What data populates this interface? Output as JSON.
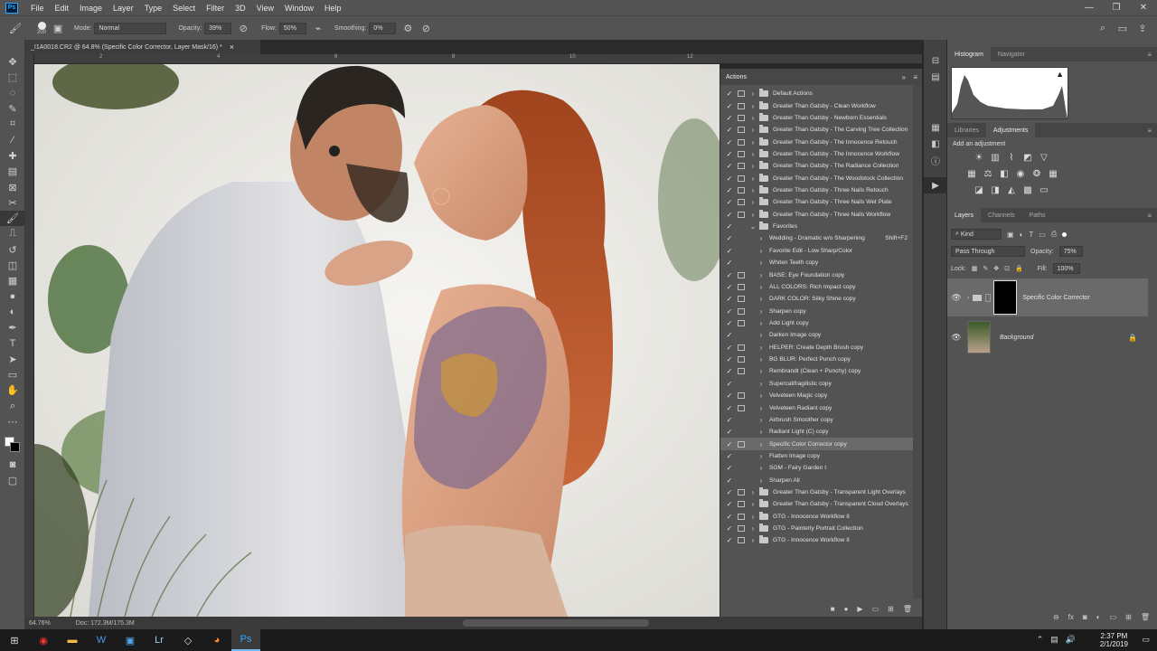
{
  "app": {
    "logo": "Ps"
  },
  "menubar": {
    "items": [
      "File",
      "Edit",
      "Image",
      "Layer",
      "Type",
      "Select",
      "Filter",
      "3D",
      "View",
      "Window",
      "Help"
    ],
    "controls": [
      "—",
      "❐",
      "✕"
    ]
  },
  "options": {
    "brush_size": "200",
    "mode_label": "Mode:",
    "mode_value": "Normal",
    "opacity_label": "Opacity:",
    "opacity_value": "39%",
    "flow_label": "Flow:",
    "flow_value": "50%",
    "smoothing_label": "Smoothing:",
    "smoothing_value": "0%"
  },
  "document": {
    "tab_title": "_I1A0018.CR2 @ 64.8% (Specific Color Corrector, Layer Mask/16) *",
    "close": "×",
    "zoom": "64.76%",
    "doc_info": "Doc: 172.3M/175.3M"
  },
  "rulers": {
    "top_marks": [
      "0",
      "2",
      "4",
      "6",
      "8",
      "10",
      "12"
    ]
  },
  "actions": {
    "title": "Actions",
    "items": [
      {
        "check": "✓",
        "dialog": true,
        "arrow": "›",
        "folder": true,
        "name": "Default Actions",
        "selected": false
      },
      {
        "check": "✓",
        "dialog": true,
        "arrow": "›",
        "folder": true,
        "name": "Greater Than Gatsby - Clean Workflow",
        "selected": false
      },
      {
        "check": "✓",
        "dialog": true,
        "arrow": "›",
        "folder": true,
        "name": "Greater Than Gatsby - Newborn Essentials",
        "selected": false
      },
      {
        "check": "✓",
        "dialog": true,
        "arrow": "›",
        "folder": true,
        "name": "Greater Than Gatsby - The Carving Tree Collection",
        "selected": false
      },
      {
        "check": "✓",
        "dialog": true,
        "arrow": "›",
        "folder": true,
        "name": "Greater Than Gatsby - The Innocence Retouch",
        "selected": false
      },
      {
        "check": "✓",
        "dialog": true,
        "arrow": "›",
        "folder": true,
        "name": "Greater Than Gatsby - The Innocence Workflow",
        "selected": false
      },
      {
        "check": "✓",
        "dialog": true,
        "arrow": "›",
        "folder": true,
        "name": "Greater Than Gatsby - The Radiance Collection",
        "selected": false
      },
      {
        "check": "✓",
        "dialog": true,
        "arrow": "›",
        "folder": true,
        "name": "Greater Than Gatsby - The Woodstock Collection",
        "selected": false
      },
      {
        "check": "✓",
        "dialog": true,
        "arrow": "›",
        "folder": true,
        "name": "Greater Than Gatsby - Three Nails Retouch",
        "selected": false
      },
      {
        "check": "✓",
        "dialog": true,
        "arrow": "›",
        "folder": true,
        "name": "Greater Than Gatsby - Three Nails Wet Plate",
        "selected": false
      },
      {
        "check": "✓",
        "dialog": true,
        "arrow": "›",
        "folder": true,
        "name": "Greater Than Gatsby - Three Nails Workflow",
        "selected": false
      },
      {
        "check": "✓",
        "dialog": false,
        "arrow": "⌄",
        "folder": true,
        "name": "Favorites",
        "selected": false
      },
      {
        "check": "✓",
        "dialog": false,
        "arrow": "›",
        "folder": false,
        "name": "Wedding - Dramatic w/o Sharpening",
        "shortcut": "Shift+F2",
        "selected": false
      },
      {
        "check": "✓",
        "dialog": false,
        "arrow": "›",
        "folder": false,
        "name": "Favorite Edit - Low Sharp/Color",
        "selected": false
      },
      {
        "check": "✓",
        "dialog": false,
        "arrow": "›",
        "folder": false,
        "name": "Whiten Teeth copy",
        "selected": false
      },
      {
        "check": "✓",
        "dialog": true,
        "arrow": "›",
        "folder": false,
        "name": "BASE: Eye Foundation copy",
        "selected": false
      },
      {
        "check": "✓",
        "dialog": true,
        "arrow": "›",
        "folder": false,
        "name": "ALL COLORS: Rich Impact copy",
        "selected": false
      },
      {
        "check": "✓",
        "dialog": true,
        "arrow": "›",
        "folder": false,
        "name": "DARK COLOR: Silky Shine copy",
        "selected": false
      },
      {
        "check": "✓",
        "dialog": true,
        "arrow": "›",
        "folder": false,
        "name": "Sharpen copy",
        "selected": false
      },
      {
        "check": "✓",
        "dialog": true,
        "arrow": "›",
        "folder": false,
        "name": "Add Light copy",
        "selected": false
      },
      {
        "check": "✓",
        "dialog": false,
        "arrow": "›",
        "folder": false,
        "name": "Darken Image copy",
        "selected": false
      },
      {
        "check": "✓",
        "dialog": true,
        "arrow": "›",
        "folder": false,
        "name": "HELPER: Create Depth Brush copy",
        "selected": false
      },
      {
        "check": "✓",
        "dialog": true,
        "arrow": "›",
        "folder": false,
        "name": "BG BLUR: Perfect Punch copy",
        "selected": false
      },
      {
        "check": "✓",
        "dialog": true,
        "arrow": "›",
        "folder": false,
        "name": "Rembrandt  (Clean + Punchy) copy",
        "selected": false
      },
      {
        "check": "✓",
        "dialog": false,
        "arrow": "›",
        "folder": false,
        "name": "Supercalifragilistic copy",
        "selected": false
      },
      {
        "check": "✓",
        "dialog": true,
        "arrow": "›",
        "folder": false,
        "name": "Velveteen Magic copy",
        "selected": false
      },
      {
        "check": "✓",
        "dialog": true,
        "arrow": "›",
        "folder": false,
        "name": "Velveteen Radiant copy",
        "selected": false
      },
      {
        "check": "✓",
        "dialog": false,
        "arrow": "›",
        "folder": false,
        "name": "Airbrush Smoother copy",
        "selected": false
      },
      {
        "check": "✓",
        "dialog": false,
        "arrow": "›",
        "folder": false,
        "name": "Radiant Light  (C) copy",
        "selected": false
      },
      {
        "check": "✓",
        "dialog": true,
        "arrow": "›",
        "folder": false,
        "name": "Specific Color Corrector copy",
        "selected": true
      },
      {
        "check": "✓",
        "dialog": false,
        "arrow": "›",
        "folder": false,
        "name": "Flatten Image copy",
        "selected": false
      },
      {
        "check": "✓",
        "dialog": false,
        "arrow": "›",
        "folder": false,
        "name": "SGM - Fairy Garden I",
        "selected": false
      },
      {
        "check": "✓",
        "dialog": false,
        "arrow": "›",
        "folder": false,
        "name": "Sharpen All",
        "selected": false
      },
      {
        "check": "✓",
        "dialog": true,
        "arrow": "›",
        "folder": true,
        "name": "Greater Than Gatsby - Transparent Light Overlays",
        "selected": false
      },
      {
        "check": "✓",
        "dialog": true,
        "arrow": "›",
        "folder": true,
        "name": "Greater Than Gatsby - Transparent Cloud Overlays",
        "selected": false
      },
      {
        "check": "✓",
        "dialog": true,
        "arrow": "›",
        "folder": true,
        "name": "GTG - Innocence Workflow II",
        "selected": false
      },
      {
        "check": "✓",
        "dialog": true,
        "arrow": "›",
        "folder": true,
        "name": "GTG - Painterly Portrait Collection",
        "selected": false
      },
      {
        "check": "✓",
        "dialog": true,
        "arrow": "›",
        "folder": true,
        "name": "GTG - Innocence Workflow II",
        "selected": false
      }
    ]
  },
  "histogram": {
    "tabs": [
      "Histogram",
      "Navigator"
    ],
    "warning": "▲"
  },
  "adjustments": {
    "tabs": [
      "Libraries",
      "Adjustments"
    ],
    "heading": "Add an adjustment"
  },
  "layers": {
    "tabs": [
      "Layers",
      "Channels",
      "Paths"
    ],
    "kind": "Kind",
    "blend_mode": "Pass Through",
    "opacity_label": "Opacity:",
    "opacity_value": "75%",
    "lock_label": "Lock:",
    "fill_label": "Fill:",
    "fill_value": "100%",
    "items": [
      {
        "name": "Specific Color Corrector",
        "selected": true
      },
      {
        "name": "Background",
        "selected": false
      }
    ]
  },
  "taskbar": {
    "time": "2:37 PM",
    "date": "2/1/2019"
  },
  "colors": {
    "ui_dark": "#535353",
    "panel_tab": "#454545",
    "selection": "#6a6a6a",
    "accent_blue": "#31a8ff"
  }
}
